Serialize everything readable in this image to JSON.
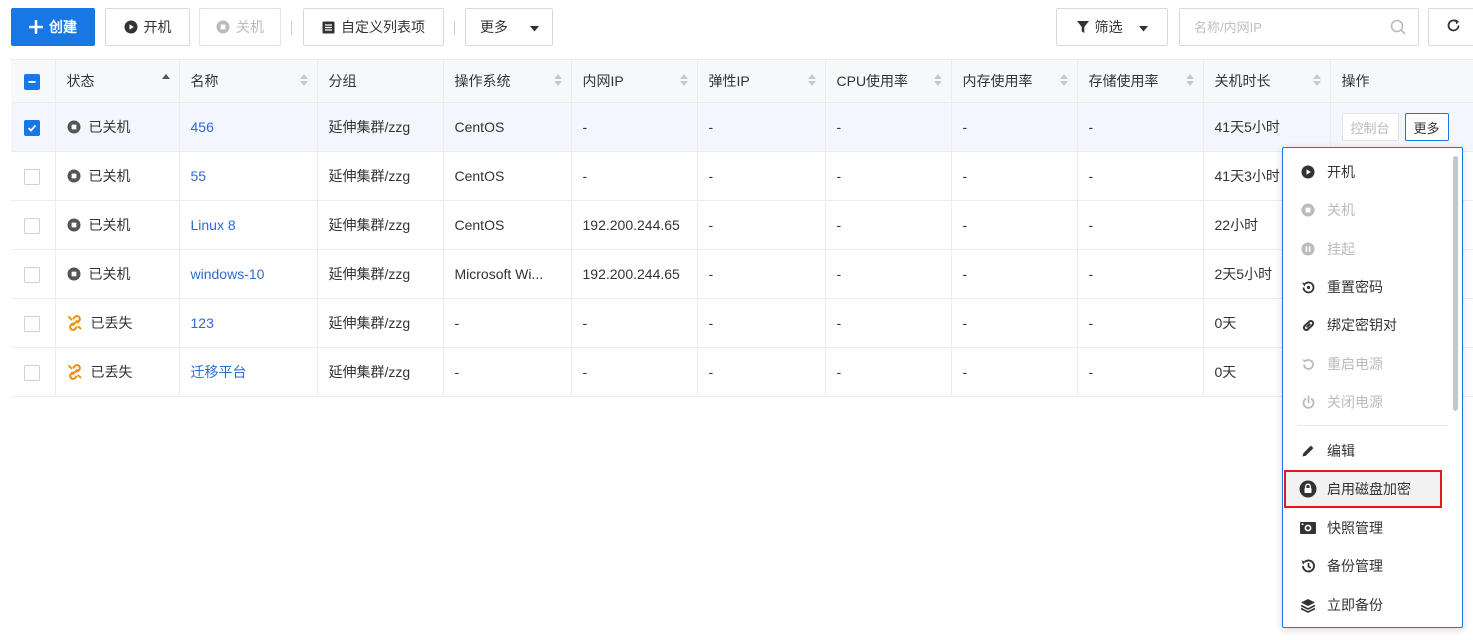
{
  "toolbar": {
    "create": "创建",
    "power_on": "开机",
    "power_off": "关机",
    "custom_columns": "自定义列表项",
    "more": "更多",
    "filter": "筛选",
    "search_placeholder": "名称/内网IP"
  },
  "table": {
    "headers": {
      "status": "状态",
      "name": "名称",
      "group": "分组",
      "os": "操作系统",
      "private_ip": "内网IP",
      "elastic_ip": "弹性IP",
      "cpu": "CPU使用率",
      "memory": "内存使用率",
      "storage": "存储使用率",
      "shutdown_duration": "关机时长",
      "actions": "操作"
    },
    "rows": [
      {
        "status": "已关机",
        "name": "456",
        "group": "延伸集群/zzg",
        "os": "CentOS",
        "private_ip": "-",
        "elastic_ip": "-",
        "cpu": "-",
        "memory": "-",
        "storage": "-",
        "shutdown_duration": "41天5小时"
      },
      {
        "status": "已关机",
        "name": "55",
        "group": "延伸集群/zzg",
        "os": "CentOS",
        "private_ip": "-",
        "elastic_ip": "-",
        "cpu": "-",
        "memory": "-",
        "storage": "-",
        "shutdown_duration": "41天3小时"
      },
      {
        "status": "已关机",
        "name": "Linux 8",
        "group": "延伸集群/zzg",
        "os": "CentOS",
        "private_ip": "192.200.244.65",
        "elastic_ip": "-",
        "cpu": "-",
        "memory": "-",
        "storage": "-",
        "shutdown_duration": "22小时"
      },
      {
        "status": "已关机",
        "name": "windows-10",
        "group": "延伸集群/zzg",
        "os": "Microsoft Wi...",
        "private_ip": "192.200.244.65",
        "elastic_ip": "-",
        "cpu": "-",
        "memory": "-",
        "storage": "-",
        "shutdown_duration": "2天5小时"
      },
      {
        "status": "已丢失",
        "name": "123",
        "group": "延伸集群/zzg",
        "os": "-",
        "private_ip": "-",
        "elastic_ip": "-",
        "cpu": "-",
        "memory": "-",
        "storage": "-",
        "shutdown_duration": "0天"
      },
      {
        "status": "已丢失",
        "name": "迁移平台",
        "group": "延伸集群/zzg",
        "os": "-",
        "private_ip": "-",
        "elastic_ip": "-",
        "cpu": "-",
        "memory": "-",
        "storage": "-",
        "shutdown_duration": "0天"
      }
    ],
    "row_actions": {
      "console": "控制台",
      "more": "更多"
    }
  },
  "menu": {
    "items": [
      {
        "label": "开机",
        "icon": "play-circle-icon",
        "disabled": false
      },
      {
        "label": "关机",
        "icon": "stop-circle-icon",
        "disabled": true
      },
      {
        "label": "挂起",
        "icon": "pause-circle-icon",
        "disabled": true
      },
      {
        "label": "重置密码",
        "icon": "reset-password-icon",
        "disabled": false
      },
      {
        "label": "绑定密钥对",
        "icon": "link-icon",
        "disabled": false
      },
      {
        "label": "重启电源",
        "icon": "restart-icon",
        "disabled": true
      },
      {
        "label": "关闭电源",
        "icon": "power-icon",
        "disabled": true
      },
      {
        "label": "编辑",
        "icon": "pencil-icon",
        "disabled": false
      },
      {
        "label": "启用磁盘加密",
        "icon": "lock-icon",
        "disabled": false,
        "highlighted": true
      },
      {
        "label": "快照管理",
        "icon": "snapshot-icon",
        "disabled": false
      },
      {
        "label": "备份管理",
        "icon": "history-icon",
        "disabled": false
      },
      {
        "label": "立即备份",
        "icon": "layers-icon",
        "disabled": false
      }
    ]
  },
  "colors": {
    "primary": "#1677e5",
    "link": "#2d6bd8",
    "lost_status": "#f08c00",
    "highlight_border": "#e01b1b"
  }
}
